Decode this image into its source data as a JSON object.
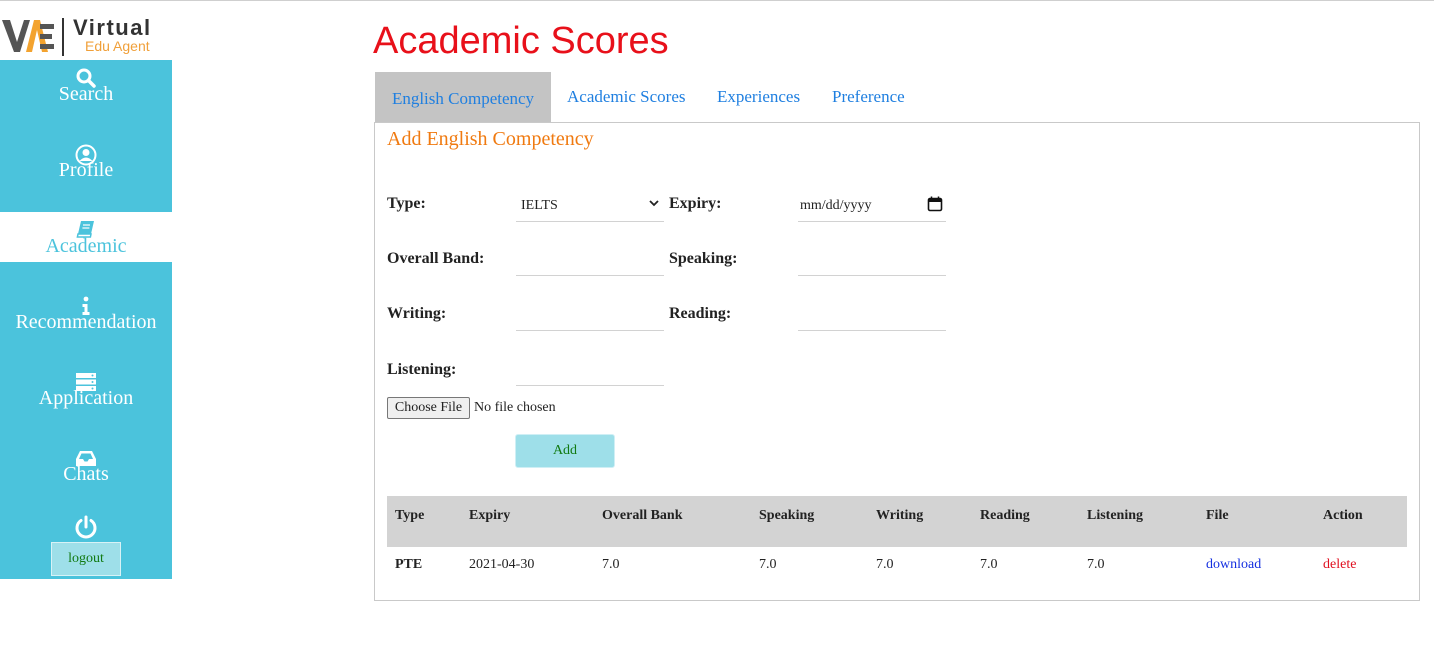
{
  "logo": {
    "title": "Virtual",
    "subtitle": "Edu Agent"
  },
  "sidebar": {
    "items": [
      {
        "label": "Search",
        "icon": "search-icon"
      },
      {
        "label": "Profile",
        "icon": "user-icon"
      },
      {
        "label": "Academic",
        "icon": "book-icon",
        "active": true
      },
      {
        "label": "Recommendation",
        "icon": "info-icon"
      },
      {
        "label": "Application",
        "icon": "server-icon"
      },
      {
        "label": "Chats",
        "icon": "inbox-icon"
      }
    ],
    "logout_icon": "power-icon",
    "logout_label": "logout"
  },
  "page": {
    "title": "Academic Scores"
  },
  "tabs": [
    {
      "label": "English Competency",
      "active": true
    },
    {
      "label": "Academic Scores"
    },
    {
      "label": "Experiences"
    },
    {
      "label": "Preference"
    }
  ],
  "form": {
    "title": "Add English Competency",
    "type_label": "Type:",
    "type_value": "IELTS",
    "expiry_label": "Expiry:",
    "expiry_placeholder": "mm/dd/yyyy",
    "overall_label": "Overall Band:",
    "speaking_label": "Speaking:",
    "writing_label": "Writing:",
    "reading_label": "Reading:",
    "listening_label": "Listening:",
    "file_button": "Choose File",
    "file_status": "No file chosen",
    "add_button": "Add"
  },
  "table": {
    "headers": [
      "Type",
      "Expiry",
      "Overall Bank",
      "Speaking",
      "Writing",
      "Reading",
      "Listening",
      "File",
      "Action"
    ],
    "rows": [
      [
        "PTE",
        "2021-04-30",
        "7.0",
        "7.0",
        "7.0",
        "7.0",
        "7.0",
        "download",
        "delete"
      ]
    ]
  },
  "colors": {
    "sidebar": "#4bc3dc",
    "title": "#e8101a",
    "form_title": "#f07a10",
    "tab_link": "#1f7fe0",
    "button": "#9edfe9"
  }
}
